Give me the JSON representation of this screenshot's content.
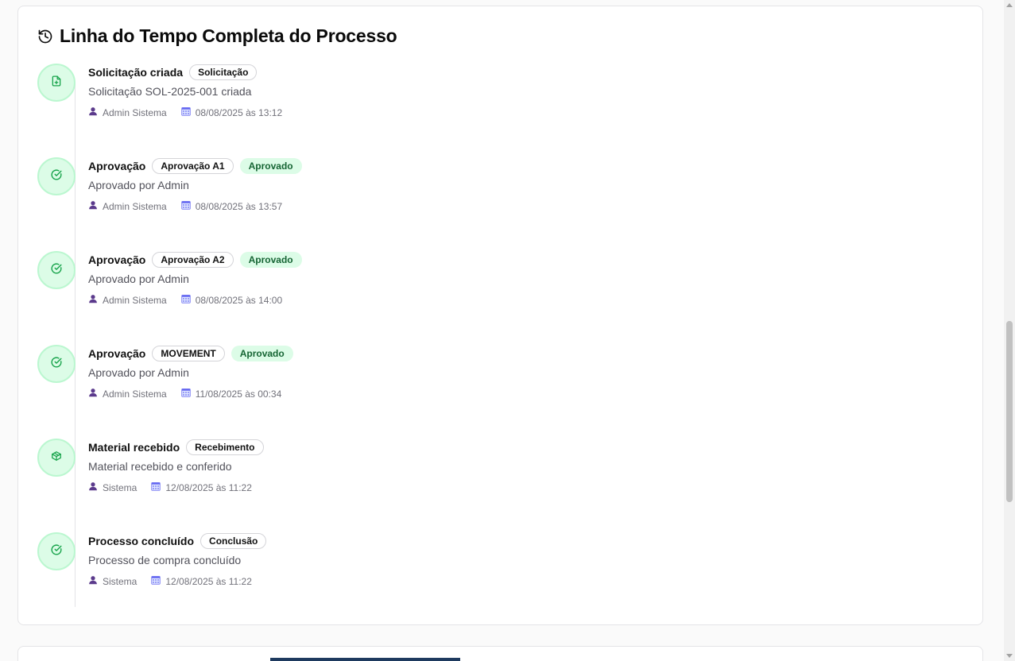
{
  "card": {
    "title": "Linha do Tempo Completa do Processo",
    "title_icon": "history-icon"
  },
  "events": [
    {
      "icon": "file-plus-icon",
      "title": "Solicitação criada",
      "tag": "Solicitação",
      "status": null,
      "description": "Solicitação SOL-2025-001 criada",
      "user": "Admin Sistema",
      "date": "08/08/2025 às 13:12"
    },
    {
      "icon": "check-circle-icon",
      "title": "Aprovação",
      "tag": "Aprovação A1",
      "status": "Aprovado",
      "description": "Aprovado por Admin",
      "user": "Admin Sistema",
      "date": "08/08/2025 às 13:57"
    },
    {
      "icon": "check-circle-icon",
      "title": "Aprovação",
      "tag": "Aprovação A2",
      "status": "Aprovado",
      "description": "Aprovado por Admin",
      "user": "Admin Sistema",
      "date": "08/08/2025 às 14:00"
    },
    {
      "icon": "check-circle-icon",
      "title": "Aprovação",
      "tag": "MOVEMENT",
      "status": "Aprovado",
      "description": "Aprovado por Admin",
      "user": "Admin Sistema",
      "date": "11/08/2025 às 00:34"
    },
    {
      "icon": "package-icon",
      "title": "Material recebido",
      "tag": "Recebimento",
      "status": null,
      "description": "Material recebido e conferido",
      "user": "Sistema",
      "date": "12/08/2025 às 11:22"
    },
    {
      "icon": "check-circle-icon",
      "title": "Processo concluído",
      "tag": "Conclusão",
      "status": null,
      "description": "Processo de compra concluído",
      "user": "Sistema",
      "date": "12/08/2025 às 11:22"
    }
  ],
  "colors": {
    "accent_green": "#16a34a",
    "green_bg": "#dcfce7",
    "green_text": "#166534",
    "user_icon": "#5b3a8c",
    "calendar_icon": "#6366f1"
  }
}
